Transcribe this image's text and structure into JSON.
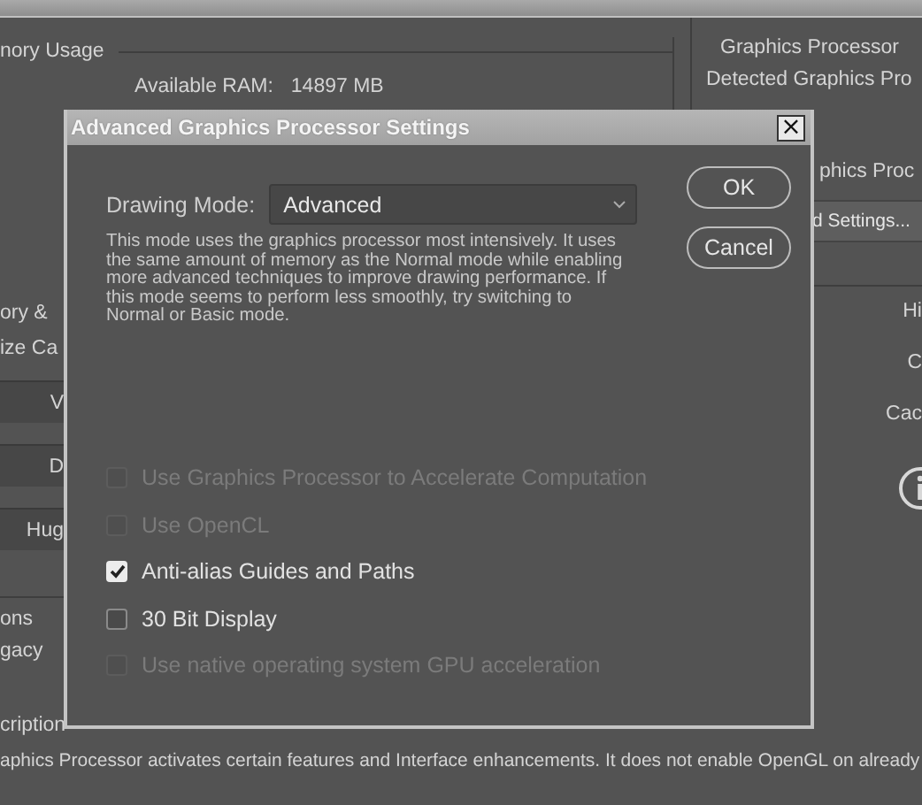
{
  "background": {
    "memory_usage": {
      "title": "nory Usage",
      "available_ram_label": "Available RAM:",
      "available_ram_value": "14897 MB"
    },
    "graphics_processor": {
      "title": "Graphics Processor",
      "detected_label": "Detected Graphics Pro",
      "setting_label": "phics Proc",
      "advanced_button": "d Settings..."
    },
    "history_cache": {
      "title": "ory &",
      "label": "ize Ca",
      "buttons": [
        "V",
        "D",
        "Hug"
      ],
      "right_labels": [
        "Hi",
        "C",
        "Cac"
      ]
    },
    "options": {
      "title": "ons",
      "label": "gacy"
    },
    "description": {
      "title": "cription",
      "text": "aphics Processor activates certain features and Interface enhancements. It does not enable OpenGL on already"
    }
  },
  "dialog": {
    "title": "Advanced Graphics Processor Settings",
    "close": "×",
    "drawing_mode": {
      "label": "Drawing Mode:",
      "value": "Advanced"
    },
    "description": "This mode uses the graphics processor most intensively.  It uses\nthe same amount of memory as the Normal mode while enabling\nmore advanced techniques to improve drawing performance.  If\nthis mode seems to perform less smoothly, try switching to\nNormal or Basic mode.",
    "buttons": [
      "OK",
      "Cancel"
    ],
    "options": [
      {
        "label": "Use Graphics Processor to Accelerate Computation",
        "checked": false,
        "disabled": true
      },
      {
        "label": "Use OpenCL",
        "checked": false,
        "disabled": true
      },
      {
        "label": "Anti-alias Guides and Paths",
        "checked": true,
        "disabled": false
      },
      {
        "label": "30 Bit Display",
        "checked": false,
        "disabled": false
      },
      {
        "label": "Use native operating system GPU acceleration",
        "checked": false,
        "disabled": true
      }
    ]
  }
}
